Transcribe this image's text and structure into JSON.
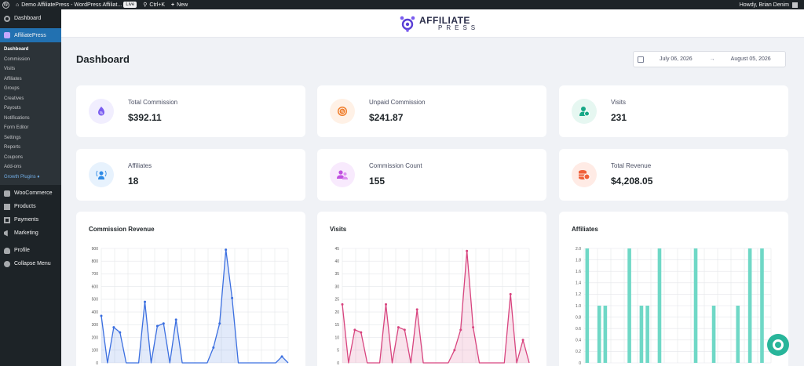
{
  "adminbar": {
    "site_name": "Demo AffiliatePress - WordPress Affiliat...",
    "live_badge": "Live",
    "shortcut": "Ctrl+K",
    "new_label": "New",
    "greeting": "Howdy, Brian Denim"
  },
  "sidebar": {
    "dashboard": "Dashboard",
    "affiliatepress": "AffiliatePress",
    "submenu": [
      "Dashboard",
      "Commission",
      "Visits",
      "Affiliates",
      "Groups",
      "Creatives",
      "Payouts",
      "Notifications",
      "Form Editor",
      "Settings",
      "Reports",
      "Coupons",
      "Add-ons",
      "Growth Plugins"
    ],
    "bottom": [
      "WooCommerce",
      "Products",
      "Payments",
      "Marketing",
      "Profile",
      "Collapse Menu"
    ]
  },
  "header": {
    "logo_line1": "AFFILIATE",
    "logo_line2": "PRESS"
  },
  "page": {
    "title": "Dashboard"
  },
  "daterange": {
    "start": "July 06, 2026",
    "end": "August 05, 2026",
    "separator": "→"
  },
  "stats": [
    {
      "label": "Total Commission",
      "value": "$392.11",
      "icon": "commission-icon",
      "color": "#7a5cf0",
      "bg": "#f1eefe"
    },
    {
      "label": "Unpaid Commission",
      "value": "$241.87",
      "icon": "unpaid-commission-icon",
      "color": "#f07d2a",
      "bg": "#fff1e6"
    },
    {
      "label": "Visits",
      "value": "231",
      "icon": "visits-icon",
      "color": "#19a887",
      "bg": "#e6f7f1"
    },
    {
      "label": "Affiliates",
      "value": "18",
      "icon": "affiliates-icon",
      "color": "#2f8be6",
      "bg": "#e7f2fd"
    },
    {
      "label": "Commission Count",
      "value": "155",
      "icon": "commission-count-icon",
      "color": "#c04fe0",
      "bg": "#f8eafd"
    },
    {
      "label": "Total Revenue",
      "value": "$4,208.05",
      "icon": "revenue-icon",
      "color": "#f0603a",
      "bg": "#ffebe5"
    }
  ],
  "chart_data": [
    {
      "type": "line",
      "title": "Commission Revenue",
      "x": [
        0,
        1,
        2,
        3,
        4,
        5,
        6,
        7,
        8,
        9,
        10,
        11,
        12,
        13,
        14,
        15,
        16,
        17,
        18,
        19,
        20,
        21,
        22,
        23,
        24,
        25,
        26,
        27,
        28,
        29,
        30
      ],
      "values": [
        370,
        0,
        280,
        240,
        0,
        0,
        0,
        480,
        0,
        290,
        310,
        0,
        340,
        0,
        0,
        0,
        0,
        0,
        120,
        310,
        890,
        510,
        0,
        0,
        0,
        0,
        0,
        0,
        0,
        50,
        0
      ],
      "yticks": [
        "0",
        "100",
        "200",
        "300",
        "400",
        "500",
        "600",
        "700",
        "800",
        "900"
      ],
      "ylim": [
        0,
        900
      ],
      "grid": true,
      "color": "#3b6fe0"
    },
    {
      "type": "line",
      "title": "Visits",
      "x": [
        0,
        1,
        2,
        3,
        4,
        5,
        6,
        7,
        8,
        9,
        10,
        11,
        12,
        13,
        14,
        15,
        16,
        17,
        18,
        19,
        20,
        21,
        22,
        23,
        24,
        25,
        26,
        27,
        28,
        29,
        30
      ],
      "values": [
        23,
        0,
        13,
        12,
        0,
        0,
        0,
        23,
        0,
        14,
        13,
        0,
        21,
        0,
        0,
        0,
        0,
        0,
        5,
        13,
        44,
        14,
        0,
        0,
        0,
        0,
        0,
        27,
        0,
        9,
        0
      ],
      "yticks": [
        "0",
        "5",
        "10",
        "15",
        "20",
        "25",
        "30",
        "35",
        "40",
        "45"
      ],
      "ylim": [
        0,
        45
      ],
      "grid": true,
      "color": "#d8457f"
    },
    {
      "type": "bar",
      "title": "Affiliates",
      "x": [
        0,
        1,
        2,
        3,
        4,
        5,
        6,
        7,
        8,
        9,
        10,
        11,
        12,
        13,
        14,
        15,
        16,
        17,
        18,
        19,
        20,
        21,
        22,
        23,
        24,
        25,
        26,
        27,
        28,
        29,
        30
      ],
      "values": [
        2,
        0,
        1,
        1,
        0,
        0,
        0,
        2,
        0,
        1,
        1,
        0,
        2,
        0,
        0,
        0,
        0,
        0,
        2,
        0,
        0,
        1,
        0,
        0,
        0,
        1,
        0,
        2,
        0,
        2,
        0
      ],
      "yticks": [
        "0",
        "0.2",
        "0.4",
        "0.6",
        "0.8",
        "1.0",
        "1.2",
        "1.4",
        "1.6",
        "1.8",
        "2.0"
      ],
      "ylim": [
        0,
        2
      ],
      "grid": true,
      "color": "#6fd8c6"
    }
  ]
}
